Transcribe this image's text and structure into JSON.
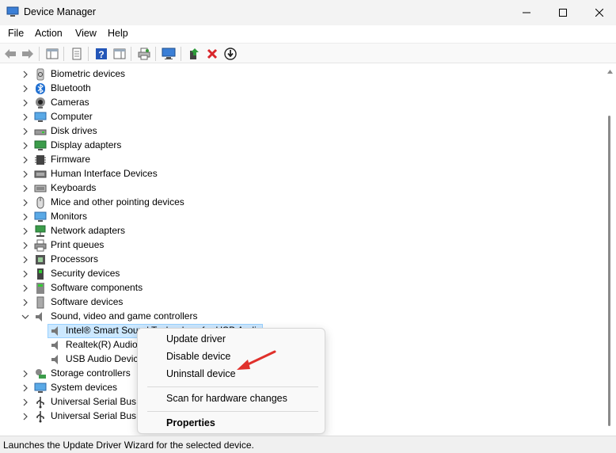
{
  "window": {
    "title": "Device Manager",
    "icon": "device-manager-icon"
  },
  "menubar": {
    "items": [
      "File",
      "Action",
      "View",
      "Help"
    ]
  },
  "tree": {
    "categories": [
      {
        "label": "Biometric devices",
        "icon": "fingerprint-icon"
      },
      {
        "label": "Bluetooth",
        "icon": "bluetooth-icon"
      },
      {
        "label": "Cameras",
        "icon": "camera-icon"
      },
      {
        "label": "Computer",
        "icon": "computer-icon"
      },
      {
        "label": "Disk drives",
        "icon": "disk-drive-icon"
      },
      {
        "label": "Display adapters",
        "icon": "display-adapter-icon"
      },
      {
        "label": "Firmware",
        "icon": "firmware-icon"
      },
      {
        "label": "Human Interface Devices",
        "icon": "hid-icon"
      },
      {
        "label": "Keyboards",
        "icon": "keyboard-icon"
      },
      {
        "label": "Mice and other pointing devices",
        "icon": "mouse-icon"
      },
      {
        "label": "Monitors",
        "icon": "monitor-icon"
      },
      {
        "label": "Network adapters",
        "icon": "network-adapter-icon"
      },
      {
        "label": "Print queues",
        "icon": "printer-icon"
      },
      {
        "label": "Processors",
        "icon": "processor-icon"
      },
      {
        "label": "Security devices",
        "icon": "security-device-icon"
      },
      {
        "label": "Software components",
        "icon": "software-component-icon"
      },
      {
        "label": "Software devices",
        "icon": "software-device-icon"
      },
      {
        "label": "Sound, video and game controllers",
        "icon": "speaker-icon"
      }
    ],
    "sound_children": [
      "Intel® Smart Sound Technology for USB Audio",
      "Realtek(R) Audio",
      "USB Audio Device"
    ],
    "after_categories": [
      {
        "label": "Storage controllers",
        "icon": "storage-controller-icon"
      },
      {
        "label": "System devices",
        "icon": "system-device-icon"
      },
      {
        "label": "Universal Serial Bus controllers",
        "icon": "usb-icon"
      },
      {
        "label": "Universal Serial Bus devices",
        "icon": "usb-icon"
      }
    ]
  },
  "context_menu": {
    "update_driver": "Update driver",
    "disable_device": "Disable device",
    "uninstall_device": "Uninstall device",
    "scan": "Scan for hardware changes",
    "properties": "Properties"
  },
  "status": {
    "text": "Launches the Update Driver Wizard for the selected device."
  },
  "colors": {
    "selection": "#cce8ff",
    "arrow": "#e0312c",
    "uninstall_x": "#d9262b"
  }
}
